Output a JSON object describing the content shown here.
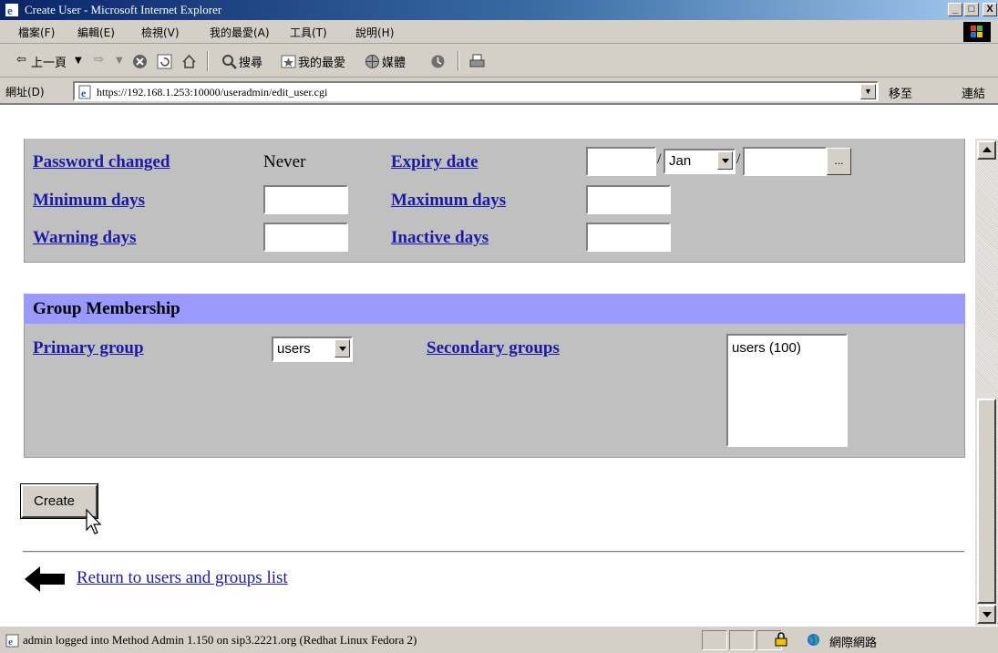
{
  "window": {
    "title": "Create User - Microsoft Internet Explorer",
    "buttons": {
      "minimize": "_",
      "maximize": "□",
      "close": "X"
    }
  },
  "menu": [
    "檔案(F)",
    "編輯(E)",
    "檢視(V)",
    "我的最愛(A)",
    "工具(T)",
    "說明(H)"
  ],
  "toolbar": {
    "back": "上一頁",
    "search": "搜尋",
    "favorites": "我的最愛",
    "media": "媒體"
  },
  "address": {
    "label": "網址(D)",
    "url": "https://192.168.1.253:10000/useradmin/edit_user.cgi",
    "go": "移至",
    "links": "連結"
  },
  "password_section": {
    "password_changed_label": "Password changed",
    "password_changed_value": "Never",
    "expiry_date_label": "Expiry date",
    "expiry_month": "Jan",
    "expiry_button": "...",
    "expiry_separator": "/",
    "minimum_days_label": "Minimum days",
    "maximum_days_label": "Maximum days",
    "warning_days_label": "Warning days",
    "inactive_days_label": "Inactive days"
  },
  "group_section": {
    "title": "Group Membership",
    "primary_group_label": "Primary group",
    "primary_group_value": "users",
    "secondary_groups_label": "Secondary groups",
    "secondary_groups_options": [
      "users (100)"
    ]
  },
  "actions": {
    "create_label": "Create",
    "return_link": "Return to users and groups list"
  },
  "status": {
    "text": "admin logged into Method Admin 1.150 on sip3.2221.org (Redhat Linux Fedora 2)",
    "zone": "網際網路"
  },
  "colors": {
    "link": "#1a1aa6",
    "section_header": "#9999ff",
    "panel": "#c0c0c0",
    "titlebar": "#0a246a"
  }
}
